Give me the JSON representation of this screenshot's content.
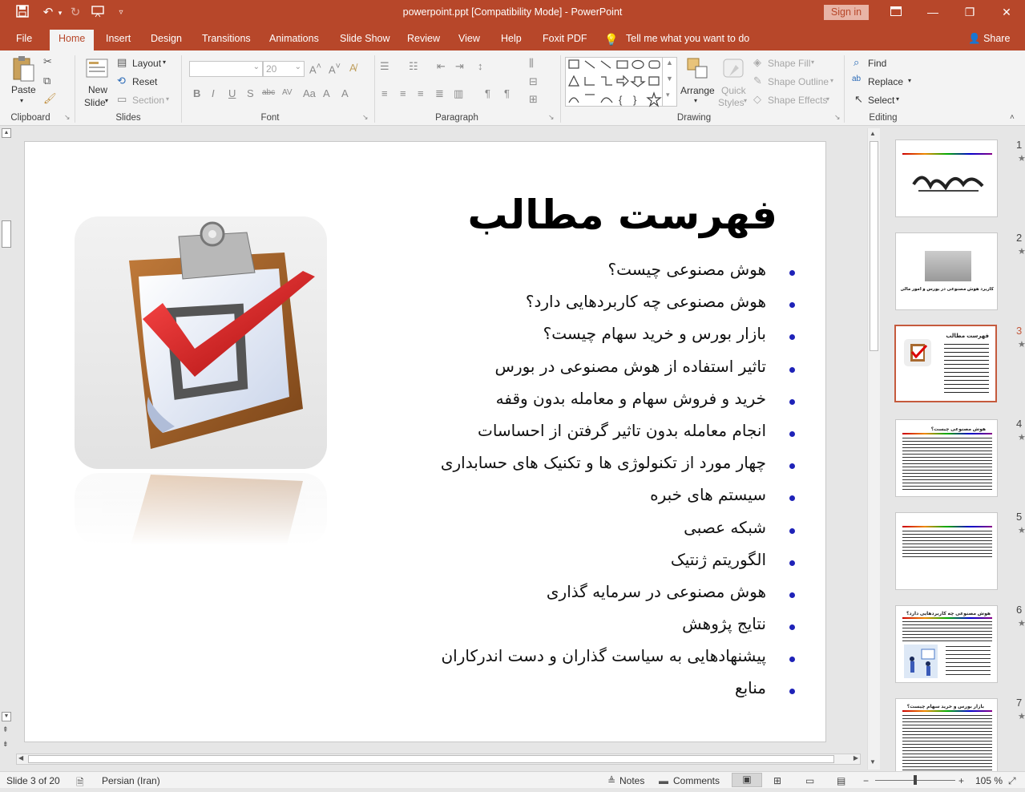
{
  "app": {
    "title": "powerpoint.ppt [Compatibility Mode]  -  PowerPoint",
    "sign_in": "Sign in"
  },
  "tabs": [
    "File",
    "Home",
    "Insert",
    "Design",
    "Transitions",
    "Animations",
    "Slide Show",
    "Review",
    "View",
    "Help",
    "Foxit PDF"
  ],
  "tell_me": "Tell me what you want to do",
  "share": "Share",
  "ribbon": {
    "clipboard": {
      "paste": "Paste",
      "label": "Clipboard"
    },
    "slides": {
      "new_slide_1": "New",
      "new_slide_2": "Slide",
      "layout": "Layout",
      "reset": "Reset",
      "section": "Section",
      "label": "Slides"
    },
    "font": {
      "size": "20",
      "label": "Font"
    },
    "paragraph": {
      "label": "Paragraph"
    },
    "drawing": {
      "arrange": "Arrange",
      "quick_styles_1": "Quick",
      "quick_styles_2": "Styles",
      "shape_fill": "Shape Fill",
      "shape_outline": "Shape Outline",
      "shape_effects": "Shape Effects",
      "label": "Drawing"
    },
    "editing": {
      "find": "Find",
      "replace": "Replace",
      "select": "Select",
      "label": "Editing"
    }
  },
  "slide": {
    "title": "فهرست مطالب",
    "bullets": [
      "هوش مصنوعی چیست؟",
      "هوش مصنوعی چه کاربردهایی دارد؟",
      "بازار بورس و خرید سهام چیست؟",
      "تاثیر استفاده از هوش مصنوعی در بورس",
      "خرید و فروش سهام و معامله بدون وقفه",
      "انجام معامله بدون تاثیر گرفتن از احساسات",
      "چهار مورد از تکنولوژی ها و تکنیک های حسابداری",
      "سیستم های خبره",
      "شبکه عصبی",
      "الگوریتم ژنتیک",
      "هوش مصنوعی در سرمایه گذاری",
      "نتایج پژوهش",
      "پیشنهادهایی به سیاست گذاران و دست اندرکاران",
      "منابع"
    ]
  },
  "thumbnails": [
    {
      "number": "1",
      "star": "★"
    },
    {
      "number": "2",
      "star": "★",
      "caption": "کاربرد هوش مصنوعی در بورس و امور مالی"
    },
    {
      "number": "3",
      "star": "★",
      "caption": "فهرست مطالب"
    },
    {
      "number": "4",
      "star": "★",
      "caption": "هوش مصنوعی چیست؟"
    },
    {
      "number": "5",
      "star": "★"
    },
    {
      "number": "6",
      "star": "★",
      "caption": "هوش مصنوعی چه کاربردهایی دارد؟"
    },
    {
      "number": "7",
      "star": "★",
      "caption": "بازار بورس و خرید سهام چیست؟"
    }
  ],
  "status": {
    "slide_of": "Slide 3 of 20",
    "language": "Persian (Iran)",
    "notes": "Notes",
    "comments": "Comments",
    "zoom": "105 %"
  },
  "colors": {
    "accent": "#b7472a",
    "bullet": "#1e22b8",
    "selected_thumb": "#c55a3d"
  }
}
